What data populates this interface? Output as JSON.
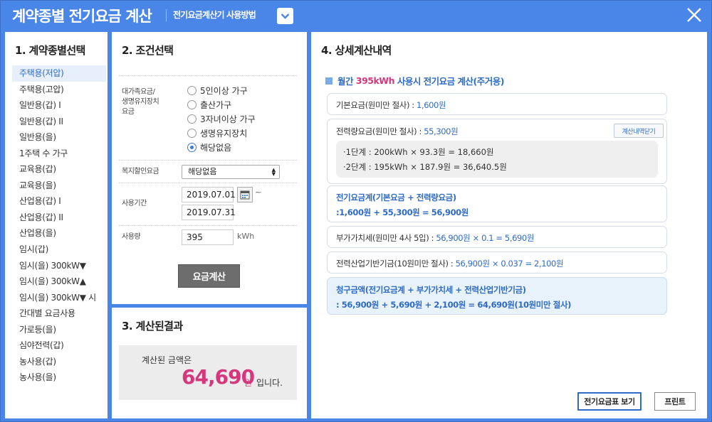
{
  "header": {
    "title": "계약종별 전기요금 계산",
    "guide_link": "전기요금계산기 사용방법",
    "guide_toggle_icon": "chevron-down-icon",
    "close_icon": "close-icon",
    "accent_color": "#4a86e8"
  },
  "section1": {
    "title": "1. 계약종별선택",
    "selected_index": 0,
    "items": [
      "주택용(저압)",
      "주택용(고압)",
      "일반용(갑) I",
      "일반용(갑) II",
      "일반용(을)",
      "1주택 수 가구",
      "교육용(갑)",
      "교육용(을)",
      "산업용(갑) I",
      "산업용(갑) II",
      "산업용(을)",
      "임시(갑)",
      "임시(을) 300kW▼",
      "임시(을) 300kW▲",
      "임시(을) 300kW▼ 시",
      "간대별 요금사용",
      "가로등(을)",
      "심야전력(갑)",
      "농사용(갑)",
      "농사용(을)"
    ]
  },
  "section2": {
    "title": "2. 조건선택",
    "discount_label_1": "대가족요금/",
    "discount_label_2": "생명유지장치",
    "discount_label_3": "요금",
    "radio_options": [
      "5인이상 가구",
      "출산가구",
      "3자녀이상 가구",
      "생명유지장치",
      "해당없음"
    ],
    "radio_selected": 4,
    "welfare_label": "복지할인요금",
    "welfare_value": "해당없음",
    "period_label": "사용기간",
    "period_start": "2019.07.01",
    "period_end": "2019.07.31",
    "period_tilde": "~",
    "calendar_icon": "calendar-icon",
    "usage_label": "사용량",
    "usage_value": "395",
    "usage_unit": "kWh",
    "calc_button": "요금계산"
  },
  "section3": {
    "title": "3. 계산된결과",
    "label": "계산된 금액은",
    "amount": "64,690",
    "won": "원",
    "suffix": "입니다."
  },
  "section4": {
    "title": "4. 상세계산내역",
    "head_pre": "월간",
    "head_kwh": "395kWh",
    "head_post": "사용시 전기요금 계산(주거용)",
    "basic_label": "기본요금(원미만 절사) :",
    "basic_value": "1,600원",
    "energy_label": "전력량요금(원미만 절사) :",
    "energy_value": "55,300원",
    "close_detail_button": "계산내역닫기",
    "step1": "·1단계 : 200kWh × 93.3원  =  18,660원",
    "step2": "·2단계 : 195kWh × 187.9원  =  36,640.5원",
    "subtotal_title": "전기요금계(기본요금 + 전력량요금)",
    "subtotal_formula": ":1,600원  +  55,300원  =  56,900원",
    "vat_label": "부가가치세(원미만 4사 5입) :",
    "vat_value": "56,900원 × 0.1  =  5,690원",
    "fund_label": "전력산업기반기금(10원미만 절사) :",
    "fund_value": "56,900원 × 0.037  =  2,100원",
    "total_title": "청구금액(전기요금계  +  부가가치세  +  전력산업기반기금)",
    "total_formula": ": 56,900원  +  5,690원  +  2,100원  =  64,690원(10원미만 절사)",
    "rate_table_button": "전기요금표 보기",
    "print_button": "프린트"
  },
  "colors": {
    "highlight_pink": "#d6367c",
    "link_blue": "#2f6bc4"
  }
}
